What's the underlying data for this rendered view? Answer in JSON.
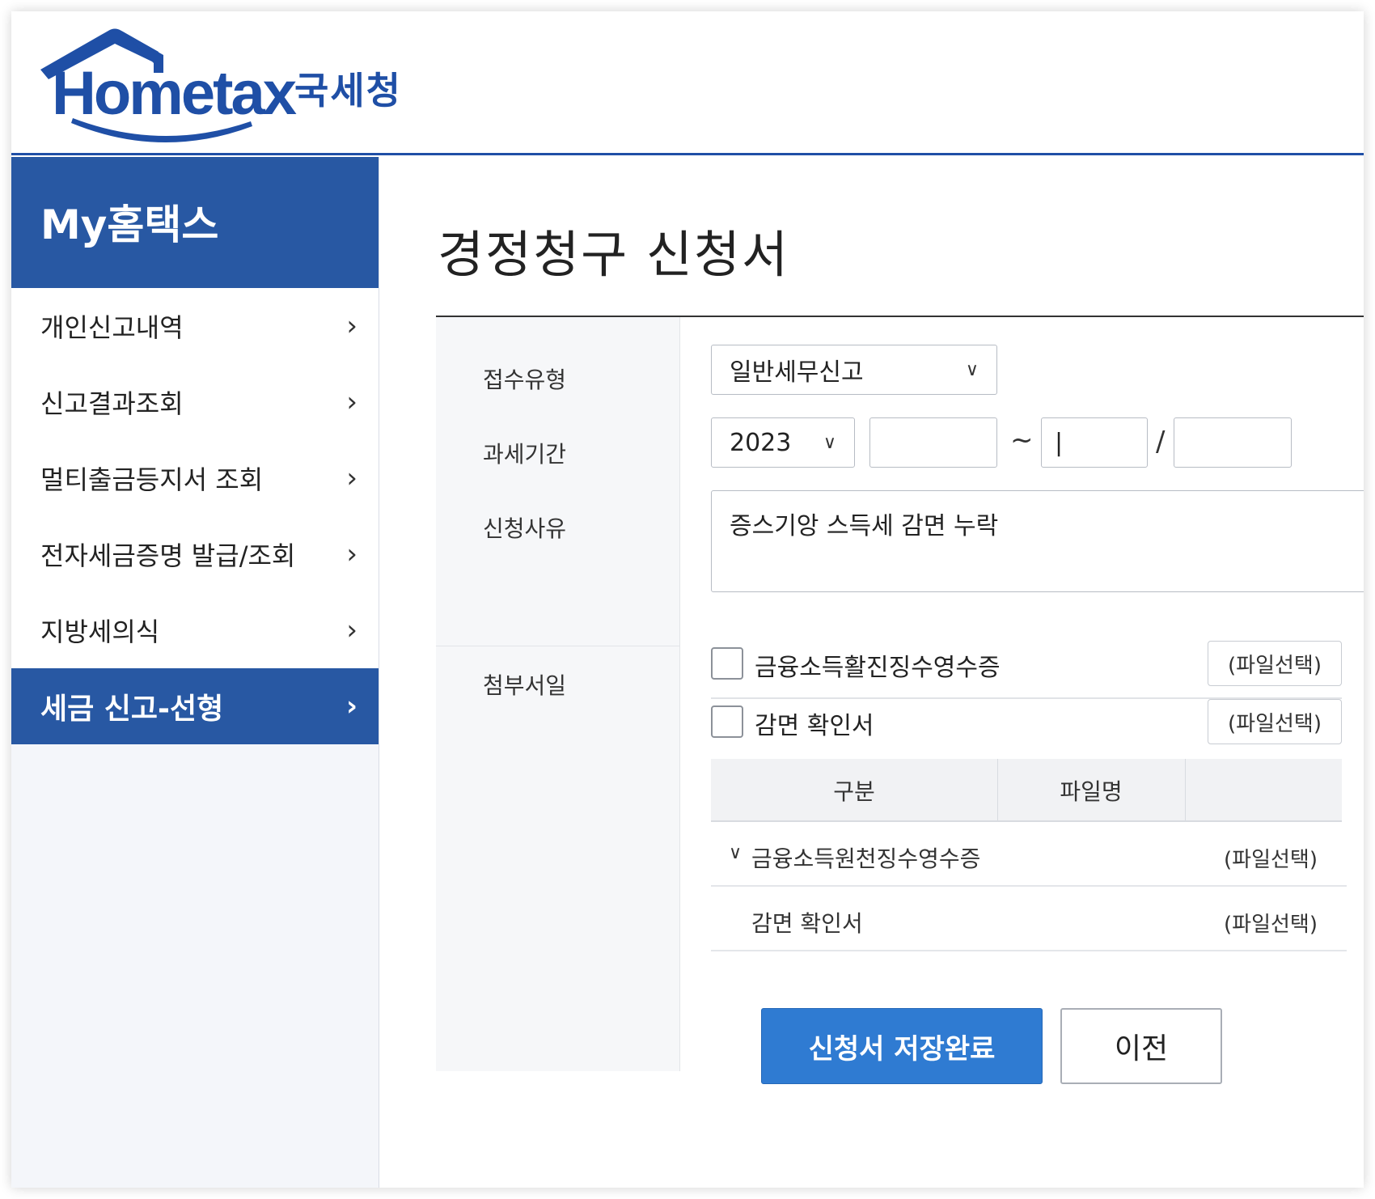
{
  "header": {
    "logo_text": "Hometax",
    "agency": "국세청"
  },
  "sidebar": {
    "title": "My홈택스",
    "items": [
      {
        "label": "개인신고내역",
        "chevron": "›"
      },
      {
        "label": "신고결과조회",
        "chevron": "›"
      },
      {
        "label": "멀티출금등지서 조회",
        "chevron": "›"
      },
      {
        "label": "전자세금증명 발급/조회",
        "chevron": "›"
      },
      {
        "label": "지방세의식",
        "chevron": "›"
      },
      {
        "label": "세금 신고-선형",
        "chevron": "›",
        "active": true
      }
    ]
  },
  "main": {
    "title": "경정청구 신청서",
    "labels": {
      "receipt_type": "접수유형",
      "tax_period": "과세기간",
      "reason": "신청사유",
      "attachments": "첨부서일"
    },
    "receipt_type_value": "일반세무신고",
    "tax_year": "2023",
    "period_start": "",
    "tilde": "~",
    "period_end": "|",
    "slash": "/",
    "period_end2": "",
    "reason_text": "증스기앙 스득세 감면 누락",
    "attachments": [
      {
        "label": "금융소득활진징수영수증",
        "button": "(파일선택)"
      },
      {
        "label": "감면 확인서",
        "button": "(파일선택)"
      }
    ],
    "table": {
      "headers": [
        "구분",
        "파일명",
        ""
      ],
      "rows": [
        {
          "chevron": "∨",
          "name": "금융소득원천징수영수증",
          "file": "(파일선택)"
        },
        {
          "chevron": "",
          "name": "감면 확인서",
          "file": "(파일선택)"
        }
      ]
    },
    "buttons": {
      "submit": "신청서 저장완료",
      "prev": "이전"
    }
  },
  "colors": {
    "brand": "#1f4fa6",
    "sidebar_active": "#2858a3",
    "primary_button": "#2f7bd2"
  }
}
